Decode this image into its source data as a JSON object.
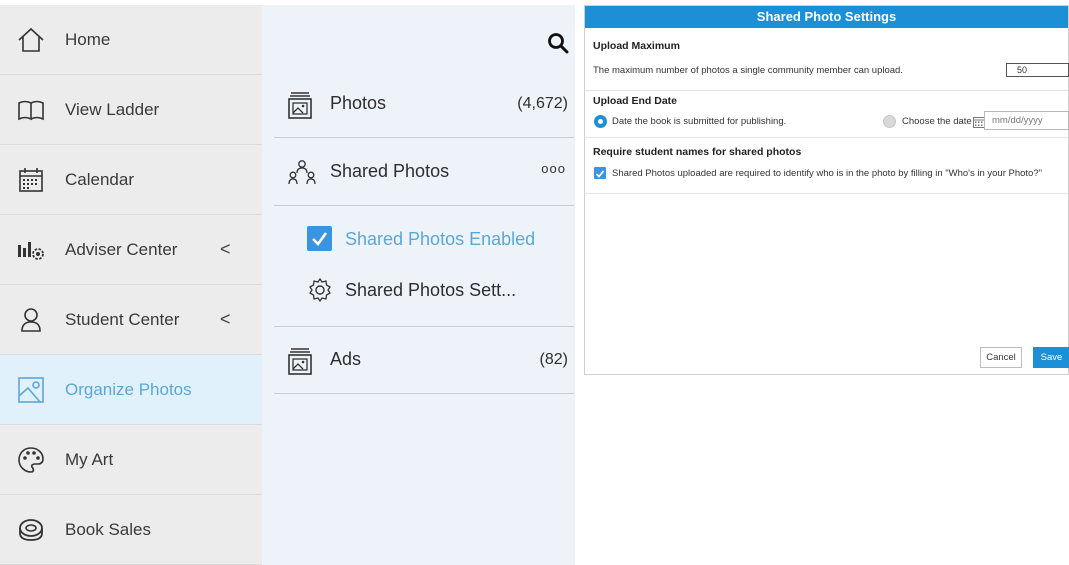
{
  "nav": {
    "items": [
      {
        "label": "Home"
      },
      {
        "label": "View Ladder"
      },
      {
        "label": "Calendar"
      },
      {
        "label": "Adviser Center",
        "chevron": "<"
      },
      {
        "label": "Student Center",
        "chevron": "<"
      },
      {
        "label": "Organize Photos"
      },
      {
        "label": "My Art"
      },
      {
        "label": "Book Sales"
      }
    ]
  },
  "panel": {
    "photos": {
      "label": "Photos",
      "count": "(4,672)"
    },
    "shared": {
      "label": "Shared Photos",
      "more": "ooo"
    },
    "enabled": {
      "label": "Shared Photos Enabled"
    },
    "settings": {
      "label": "Shared Photos Sett..."
    },
    "ads": {
      "label": "Ads",
      "count": "(82)"
    }
  },
  "dialog": {
    "title": "Shared Photo Settings",
    "upload_max": {
      "heading": "Upload Maximum",
      "text": "The maximum number of photos a single community member can upload.",
      "value": "50"
    },
    "end_date": {
      "heading": "Upload End Date",
      "option_submitted": "Date the book is submitted for publishing.",
      "option_choose": "Choose the date",
      "placeholder": "mm/dd/yyyy"
    },
    "require_names": {
      "heading": "Require student names for shared photos",
      "text": "Shared Photos uploaded are required to identify who is in the photo by filling in \"Who's in your Photo?\""
    },
    "cancel_label": "Cancel",
    "save_label": "Save"
  },
  "colors": {
    "accent": "#1c8fd6",
    "active_text": "#5aa8d8",
    "nav_bg": "#ececec",
    "panel_bg": "#eef3fa"
  }
}
